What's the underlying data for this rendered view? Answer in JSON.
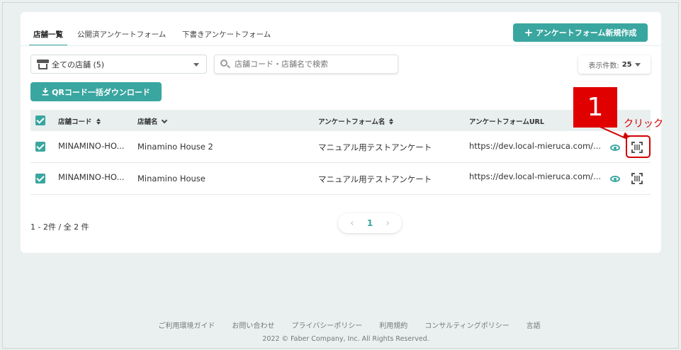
{
  "tabs": [
    {
      "label": "店舗一覧",
      "active": true
    },
    {
      "label": "公開済アンケートフォーム",
      "active": false
    },
    {
      "label": "下書きアンケートフォーム",
      "active": false
    }
  ],
  "create_button": {
    "label": "アンケートフォーム新規作成",
    "icon": "plus-icon"
  },
  "store_select": {
    "value": "全ての店舗 (5)",
    "icon": "store-icon"
  },
  "search": {
    "placeholder": "店舗コード・店舗名で検索",
    "icon": "search-icon"
  },
  "per_page": {
    "label": "表示件数:",
    "value": "25"
  },
  "qr_download": {
    "label": "QRコード一括ダウンロード",
    "icon": "download-icon"
  },
  "table": {
    "headers": {
      "store_code": "店舗コード",
      "store_name": "店舗名",
      "form_name": "アンケートフォーム名",
      "form_url": "アンケートフォームURL"
    },
    "rows": [
      {
        "checked": true,
        "store_code": "MINAMINO-HO...",
        "store_name": "Minamino House 2",
        "form_name": "マニュアル用テストアンケート",
        "form_url": "https://dev.local-mieruca.com/..."
      },
      {
        "checked": true,
        "store_code": "MINAMINO-HO...",
        "store_name": "Minamino House",
        "form_name": "マニュアル用テストアンケート",
        "form_url": "https://dev.local-mieruca.com/..."
      }
    ]
  },
  "annotation": {
    "number": "1",
    "label": "クリック",
    "color": "#e00000"
  },
  "pagination": {
    "summary": "1 - 2件 / 全 2 件",
    "current_page": "1"
  },
  "footer": {
    "links": [
      "ご利用環境ガイド",
      "お問い合わせ",
      "プライバシーポリシー",
      "利用規約",
      "コンサルティングポリシー",
      "言語"
    ],
    "copyright": "2022 © Faber Company, Inc. All Rights Reserved."
  },
  "colors": {
    "accent": "#3aa6a0",
    "background": "#eaf0f0",
    "annotation_red": "#d20000"
  }
}
